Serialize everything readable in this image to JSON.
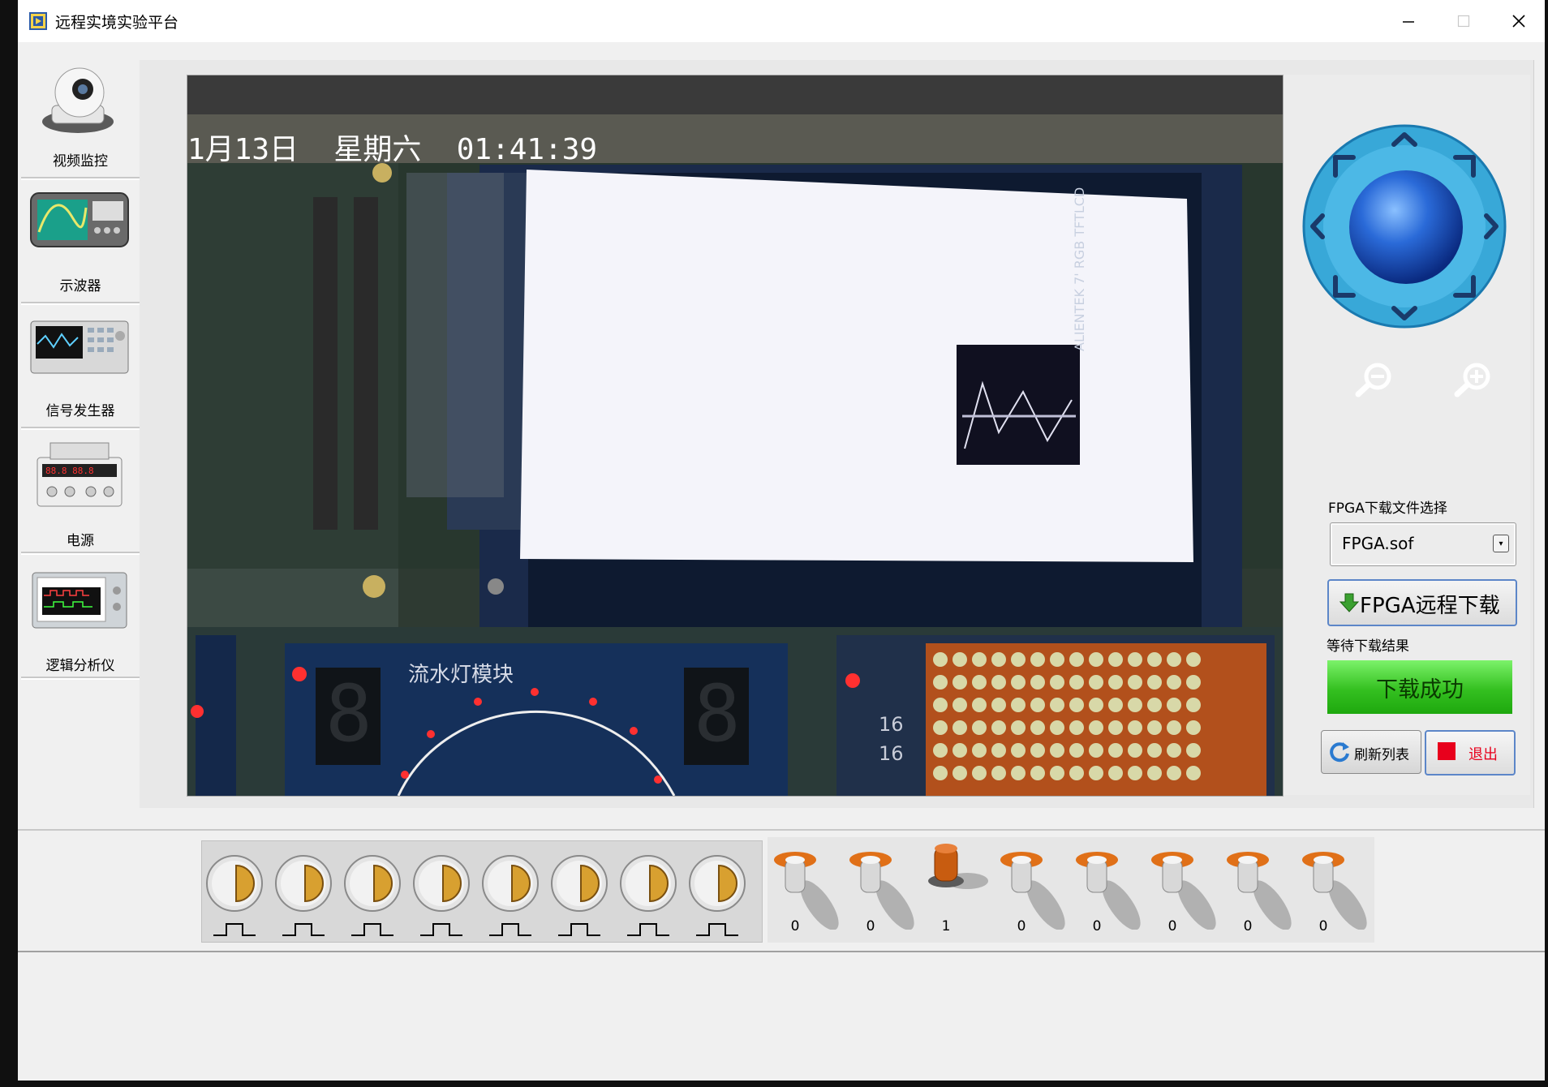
{
  "window": {
    "title": "远程实境实验平台",
    "minimize_glyph": "—",
    "maximize_glyph": "☐",
    "close_glyph": "✕"
  },
  "sidebar": {
    "items": [
      {
        "label": "视频监控",
        "icon": "security-camera-icon"
      },
      {
        "label": "示波器",
        "icon": "oscilloscope-icon"
      },
      {
        "label": "信号发生器",
        "icon": "signal-generator-icon"
      },
      {
        "label": "电源",
        "icon": "power-supply-icon"
      },
      {
        "label": "逻辑分析仪",
        "icon": "logic-analyzer-icon"
      }
    ]
  },
  "video": {
    "timestamp": "1月13日  星期六  01:41:39",
    "board_module_label": "流水灯模块",
    "display_label": "ALIENTEK 7' RGB TFTLCD",
    "matrix_label_a": "16",
    "matrix_label_b": "16"
  },
  "control": {
    "camera_joystick_icon": "ptz-joystick-icon",
    "zoom_out_icon": "zoom-out-icon",
    "zoom_in_icon": "zoom-in-icon",
    "file_select_label": "FPGA下载文件选择",
    "file_selected": "FPGA.sof",
    "download_button": "FPGA远程下载",
    "result_label": "等待下载结果",
    "result_value": "下载成功",
    "refresh_button": "刷新列表",
    "exit_button": "退出",
    "colors": {
      "success": "#34c020",
      "accent_border": "#5c86c8",
      "exit_square": "#e8001c"
    }
  },
  "push_buttons": {
    "count": 8,
    "icon": "pulse-button-icon",
    "pulse_icon": "pulse-waveform-icon"
  },
  "switches": {
    "values": [
      "0",
      "0",
      "1",
      "0",
      "0",
      "0",
      "0",
      "0"
    ]
  }
}
